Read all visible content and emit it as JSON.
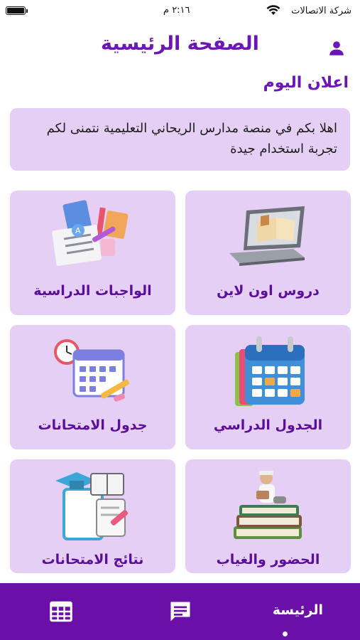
{
  "status_bar": {
    "carrier": "شركة الاتصالات",
    "time": "٢:١٦ م"
  },
  "header": {
    "title": "الصفحة الرئيسية",
    "profile_icon": "person-icon"
  },
  "announcement": {
    "title": "اعلان اليوم",
    "text": "اهلا بكم في منصة مدارس الريحاني التعليمية نتمنى لكم تجربة استخدام جيدة"
  },
  "cards": [
    {
      "label": "دروس اون لاين",
      "icon": "laptop-books-icon"
    },
    {
      "label": "الواجبات الدراسية",
      "icon": "homework-icon"
    },
    {
      "label": "الجدول الدراسي",
      "icon": "calendar-icon"
    },
    {
      "label": "جدول الامتحانات",
      "icon": "exam-calendar-icon"
    },
    {
      "label": "الحضور والغياب",
      "icon": "attendance-icon"
    },
    {
      "label": "نتائج الامتحانات",
      "icon": "exam-results-icon"
    }
  ],
  "bottom_nav": {
    "home_label": "الرئيسة",
    "messages_icon": "chat-icon",
    "schedule_icon": "table-icon"
  },
  "colors": {
    "primary": "#6b16b5",
    "nav_background": "#6a10a8",
    "card_background": "#e6cff5"
  }
}
